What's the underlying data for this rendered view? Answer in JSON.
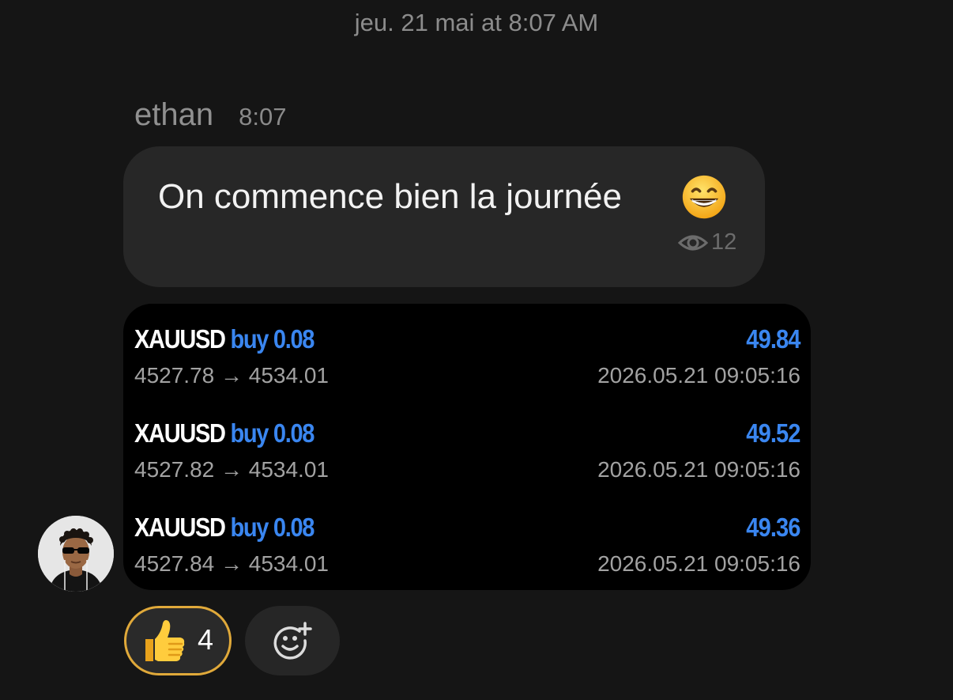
{
  "date_header": "jeu. 21 mai at 8:07 AM",
  "message": {
    "sender": "ethan",
    "time": "8:07",
    "text": "On commence bien la journée",
    "emoji": "grinning-face-emoji",
    "views": "12"
  },
  "trades": [
    {
      "symbol": "XAUUSD",
      "side": "buy 0.08",
      "profit": "49.84",
      "prices": "4527.78 → 4534.01",
      "timestamp": "2026.05.21 09:05:16"
    },
    {
      "symbol": "XAUUSD",
      "side": "buy 0.08",
      "profit": "49.52",
      "prices": "4527.82 → 4534.01",
      "timestamp": "2026.05.21 09:05:16"
    },
    {
      "symbol": "XAUUSD",
      "side": "buy 0.08",
      "profit": "49.36",
      "prices": "4527.84 → 4534.01",
      "timestamp": "2026.05.21 09:05:16"
    }
  ],
  "reactions": {
    "thumbs_up_count": "4",
    "thumbs_up_icon": "thumbs-up-emoji",
    "add_reaction_icon": "add-reaction-icon"
  },
  "colors": {
    "background": "#151515",
    "bubble": "#272727",
    "accent_blue": "#3a86f0",
    "reaction_border": "#e0a93a"
  }
}
